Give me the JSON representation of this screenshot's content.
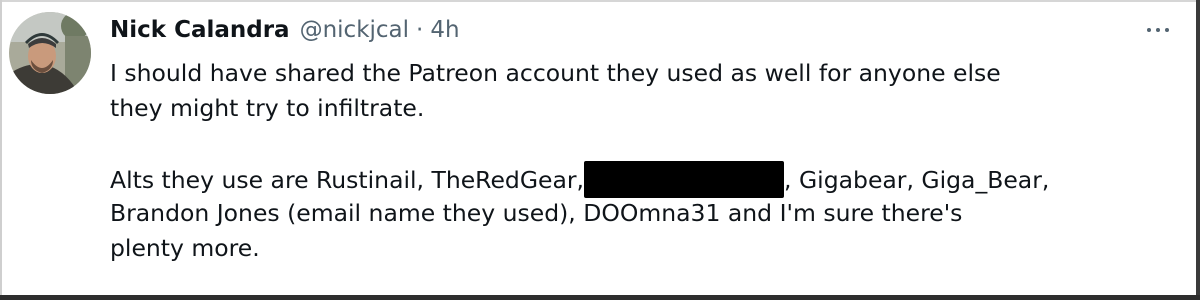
{
  "tweet": {
    "display_name": "Nick Calandra",
    "handle": "@nickjcal",
    "separator": "·",
    "time": "4h",
    "more_label": "More",
    "avatar_icon": "user-avatar",
    "text": {
      "line1": "I should have shared the Patreon account they used as well for anyone else",
      "line2": "they might try to infiltrate.",
      "line4_before": "Alts they use are Rustinail, TheRedGear,",
      "line4_after": ", Gigabear, Giga_Bear,",
      "line5": "Brandon Jones (email name they used), DOOmna31 and I'm sure there's",
      "line6": "plenty more."
    }
  },
  "colors": {
    "name": "#0f1419",
    "secondary": "#536471",
    "redaction": "#000000"
  }
}
